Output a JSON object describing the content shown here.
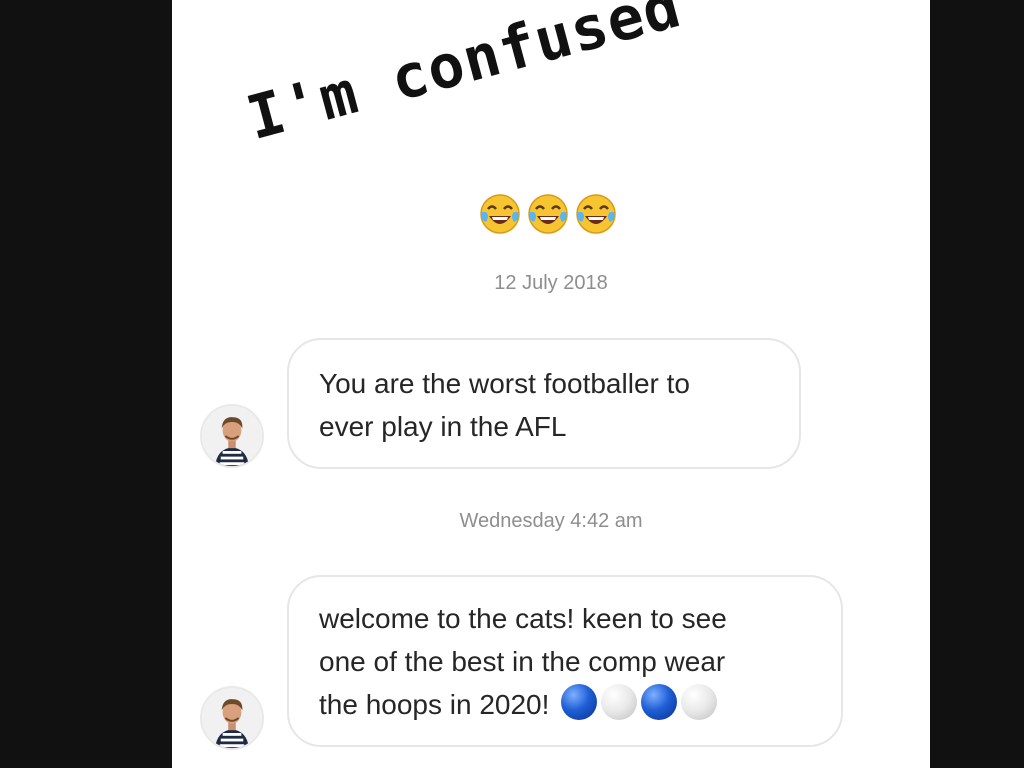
{
  "story": {
    "caption": "I'm confused",
    "emojis": [
      "face-with-tears-of-joy",
      "face-with-tears-of-joy",
      "face-with-tears-of-joy"
    ]
  },
  "chat": {
    "timestamps": [
      "12 July 2018",
      "Wednesday 4:42 am"
    ],
    "messages": [
      {
        "lines": [
          "You are the worst footballer to",
          "ever play in the AFL"
        ]
      },
      {
        "lines": [
          "welcome to the cats! keen to see",
          "one of the best in the comp wear",
          "the hoops in 2020!"
        ],
        "emoji_sequence": [
          "blue-circle",
          "white-circle",
          "blue-circle",
          "white-circle"
        ]
      }
    ]
  },
  "colors": {
    "background": "#111111",
    "screen": "#ffffff",
    "bubble_border": "#e6e6e6",
    "timestamp": "#8e8e8e",
    "text": "#262626",
    "blue_circle": "#1f5fd6"
  }
}
